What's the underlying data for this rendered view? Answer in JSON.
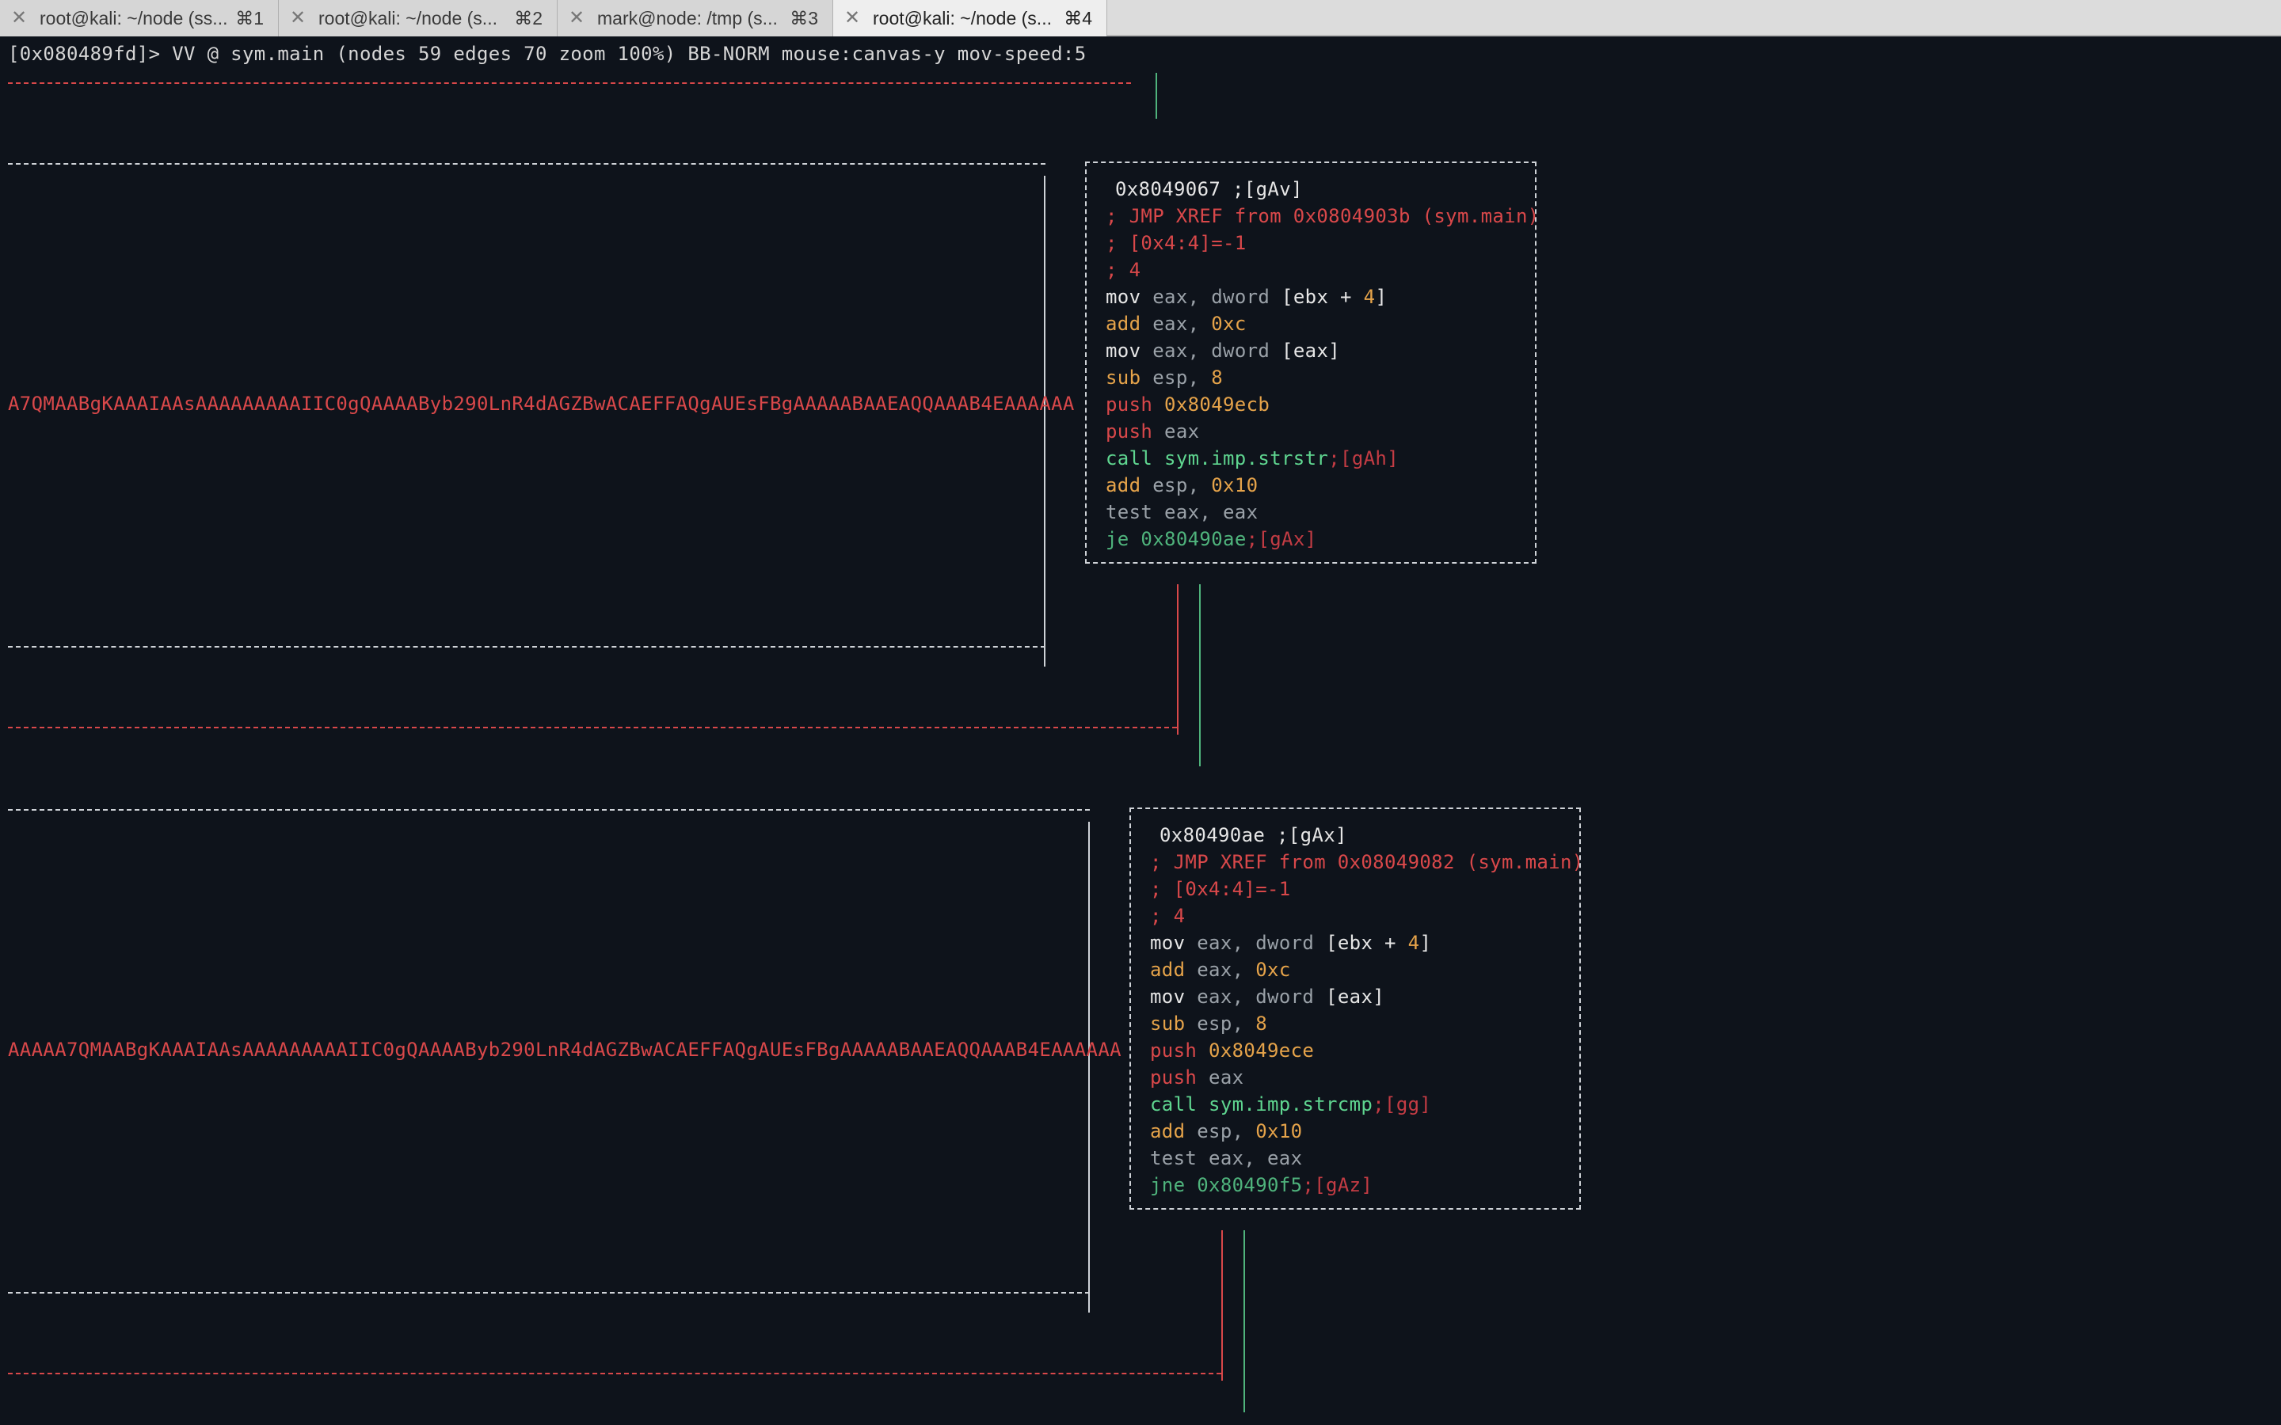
{
  "tabs": [
    {
      "label": "root@kali: ~/node (ss...",
      "shortcut": "⌘1",
      "active": false
    },
    {
      "label": "root@kali: ~/node (s...",
      "shortcut": "⌘2",
      "active": false
    },
    {
      "label": "mark@node: /tmp (s...",
      "shortcut": "⌘3",
      "active": false
    },
    {
      "label": "root@kali: ~/node (s...",
      "shortcut": "⌘4",
      "active": true
    }
  ],
  "status_line": "[0x080489fd]> VV @ sym.main (nodes 59 edges 70 zoom 100%) BB-NORM mouse:canvas-y mov-speed:5",
  "left_strings": {
    "first": "A7QMAABgKAAAIAAsAAAAAAAAAIIC0gQAAAAByb290LnR4dAGZBwACAEFFAQgAUEsFBgAAAAABAAEAQQAAAB4EAAAAAA",
    "second": "AAAAA7QMAABgKAAAIAAsAAAAAAAAAIIC0gQAAAAByb290LnR4dAGZBwACAEFFAQgAUEsFBgAAAAABAAEAQQAAAB4EAAAAAA"
  },
  "block1": {
    "addr": "0x8049067 ;[gAv]",
    "xref": "; JMP XREF from 0x0804903b (sym.main)",
    "c1": "; [0x4:4]=-1",
    "c2": "; 4",
    "i1": {
      "op": "mov",
      "a": "eax,",
      "b": "dword",
      "c": "[ebx +",
      "d": "4",
      "e": "]"
    },
    "i2": {
      "op": "add",
      "a": "eax,",
      "b": "0xc"
    },
    "i3": {
      "op": "mov",
      "a": "eax,",
      "b": "dword",
      "c": "[eax]"
    },
    "i4": {
      "op": "sub",
      "a": "esp,",
      "b": "8"
    },
    "i5": {
      "op": "push",
      "b": "0x8049ecb"
    },
    "i6": {
      "op": "push",
      "a": "eax"
    },
    "i7": {
      "op": "call",
      "b": "sym.imp.strstr",
      "c": ";[gAh]"
    },
    "i8": {
      "op": "add",
      "a": "esp,",
      "b": "0x10"
    },
    "i9": {
      "op": "test",
      "a": "eax, eax"
    },
    "i10": {
      "op": "je",
      "b": "0x80490ae",
      "c": ";[gAx]"
    }
  },
  "block2": {
    "addr": "0x80490ae ;[gAx]",
    "xref": "; JMP XREF from 0x08049082 (sym.main)",
    "c1": "; [0x4:4]=-1",
    "c2": "; 4",
    "i1": {
      "op": "mov",
      "a": "eax,",
      "b": "dword",
      "c": "[ebx +",
      "d": "4",
      "e": "]"
    },
    "i2": {
      "op": "add",
      "a": "eax,",
      "b": "0xc"
    },
    "i3": {
      "op": "mov",
      "a": "eax,",
      "b": "dword",
      "c": "[eax]"
    },
    "i4": {
      "op": "sub",
      "a": "esp,",
      "b": "8"
    },
    "i5": {
      "op": "push",
      "b": "0x8049ece"
    },
    "i6": {
      "op": "push",
      "a": "eax"
    },
    "i7": {
      "op": "call",
      "b": "sym.imp.strcmp",
      "c": ";[gg]"
    },
    "i8": {
      "op": "add",
      "a": "esp,",
      "b": "0x10"
    },
    "i9": {
      "op": "test",
      "a": "eax, eax"
    },
    "i10": {
      "op": "jne",
      "b": "0x80490f5",
      "c": ";[gAz]"
    }
  },
  "colors": {
    "background": "#0e131b",
    "red_edge": "#d9484a",
    "green_edge": "#4fb37c",
    "number": "#e5a34a",
    "call": "#5fd690"
  }
}
